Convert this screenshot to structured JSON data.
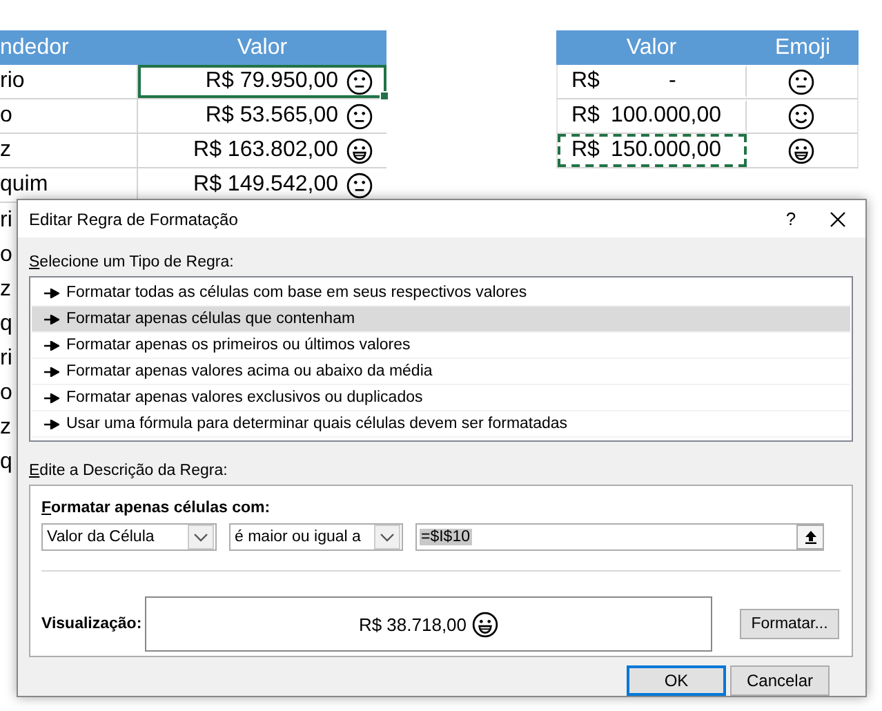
{
  "sheet_left": {
    "columns": [
      "ndedor",
      "Valor"
    ],
    "rows": [
      {
        "column_1": "rio",
        "valor": "R$ 79.950,00",
        "kind": "neutral",
        "selected": true
      },
      {
        "column_1": "o",
        "valor": "R$ 53.565,00",
        "kind": "neutral",
        "selected": false
      },
      {
        "column_1": "z",
        "valor": "R$ 163.802,00",
        "kind": "grin",
        "selected": false
      },
      {
        "column_1": "quim",
        "valor": "R$ 149.542,00",
        "kind": "neutral",
        "selected": false
      }
    ],
    "fragments": [
      "ri",
      "o",
      "z",
      "q",
      "ri",
      "o",
      "z",
      "q"
    ]
  },
  "sheet_right": {
    "columns": [
      "Valor",
      "Emoji"
    ],
    "rows": [
      {
        "currency": "R$",
        "amount": "-",
        "kind": "neutral",
        "copied": false
      },
      {
        "currency": "R$",
        "amount": "100.000,00",
        "kind": "smile",
        "copied": false
      },
      {
        "currency": "R$",
        "amount": "150.000,00",
        "kind": "grin",
        "copied": true
      }
    ]
  },
  "dialog": {
    "title": "Editar Regra de Formatação",
    "help": "?",
    "rule_type_label": "Selecione um Tipo de Regra:",
    "rule_types": [
      {
        "label": "Formatar todas as células com base em seus respectivos valores",
        "selected": false
      },
      {
        "label": "Formatar apenas células que contenham",
        "selected": true
      },
      {
        "label": "Formatar apenas os primeiros ou últimos valores",
        "selected": false
      },
      {
        "label": "Formatar apenas valores acima ou abaixo da média",
        "selected": false
      },
      {
        "label": "Formatar apenas valores exclusivos ou duplicados",
        "selected": false
      },
      {
        "label": "Usar uma fórmula para determinar quais células devem ser formatadas",
        "selected": false
      }
    ],
    "description_label": "Edite a Descrição da Regra:",
    "condition_label": "Formatar apenas células com:",
    "dropdowns": [
      "Valor da Célula",
      "é maior ou igual a"
    ],
    "formula": "=$I$10",
    "preview_label": "Visualização:",
    "preview": {
      "text": "R$ 38.718,00",
      "kind": "grin"
    },
    "format_button": "Formatar...",
    "buttons": [
      "OK",
      "Cancelar"
    ]
  }
}
